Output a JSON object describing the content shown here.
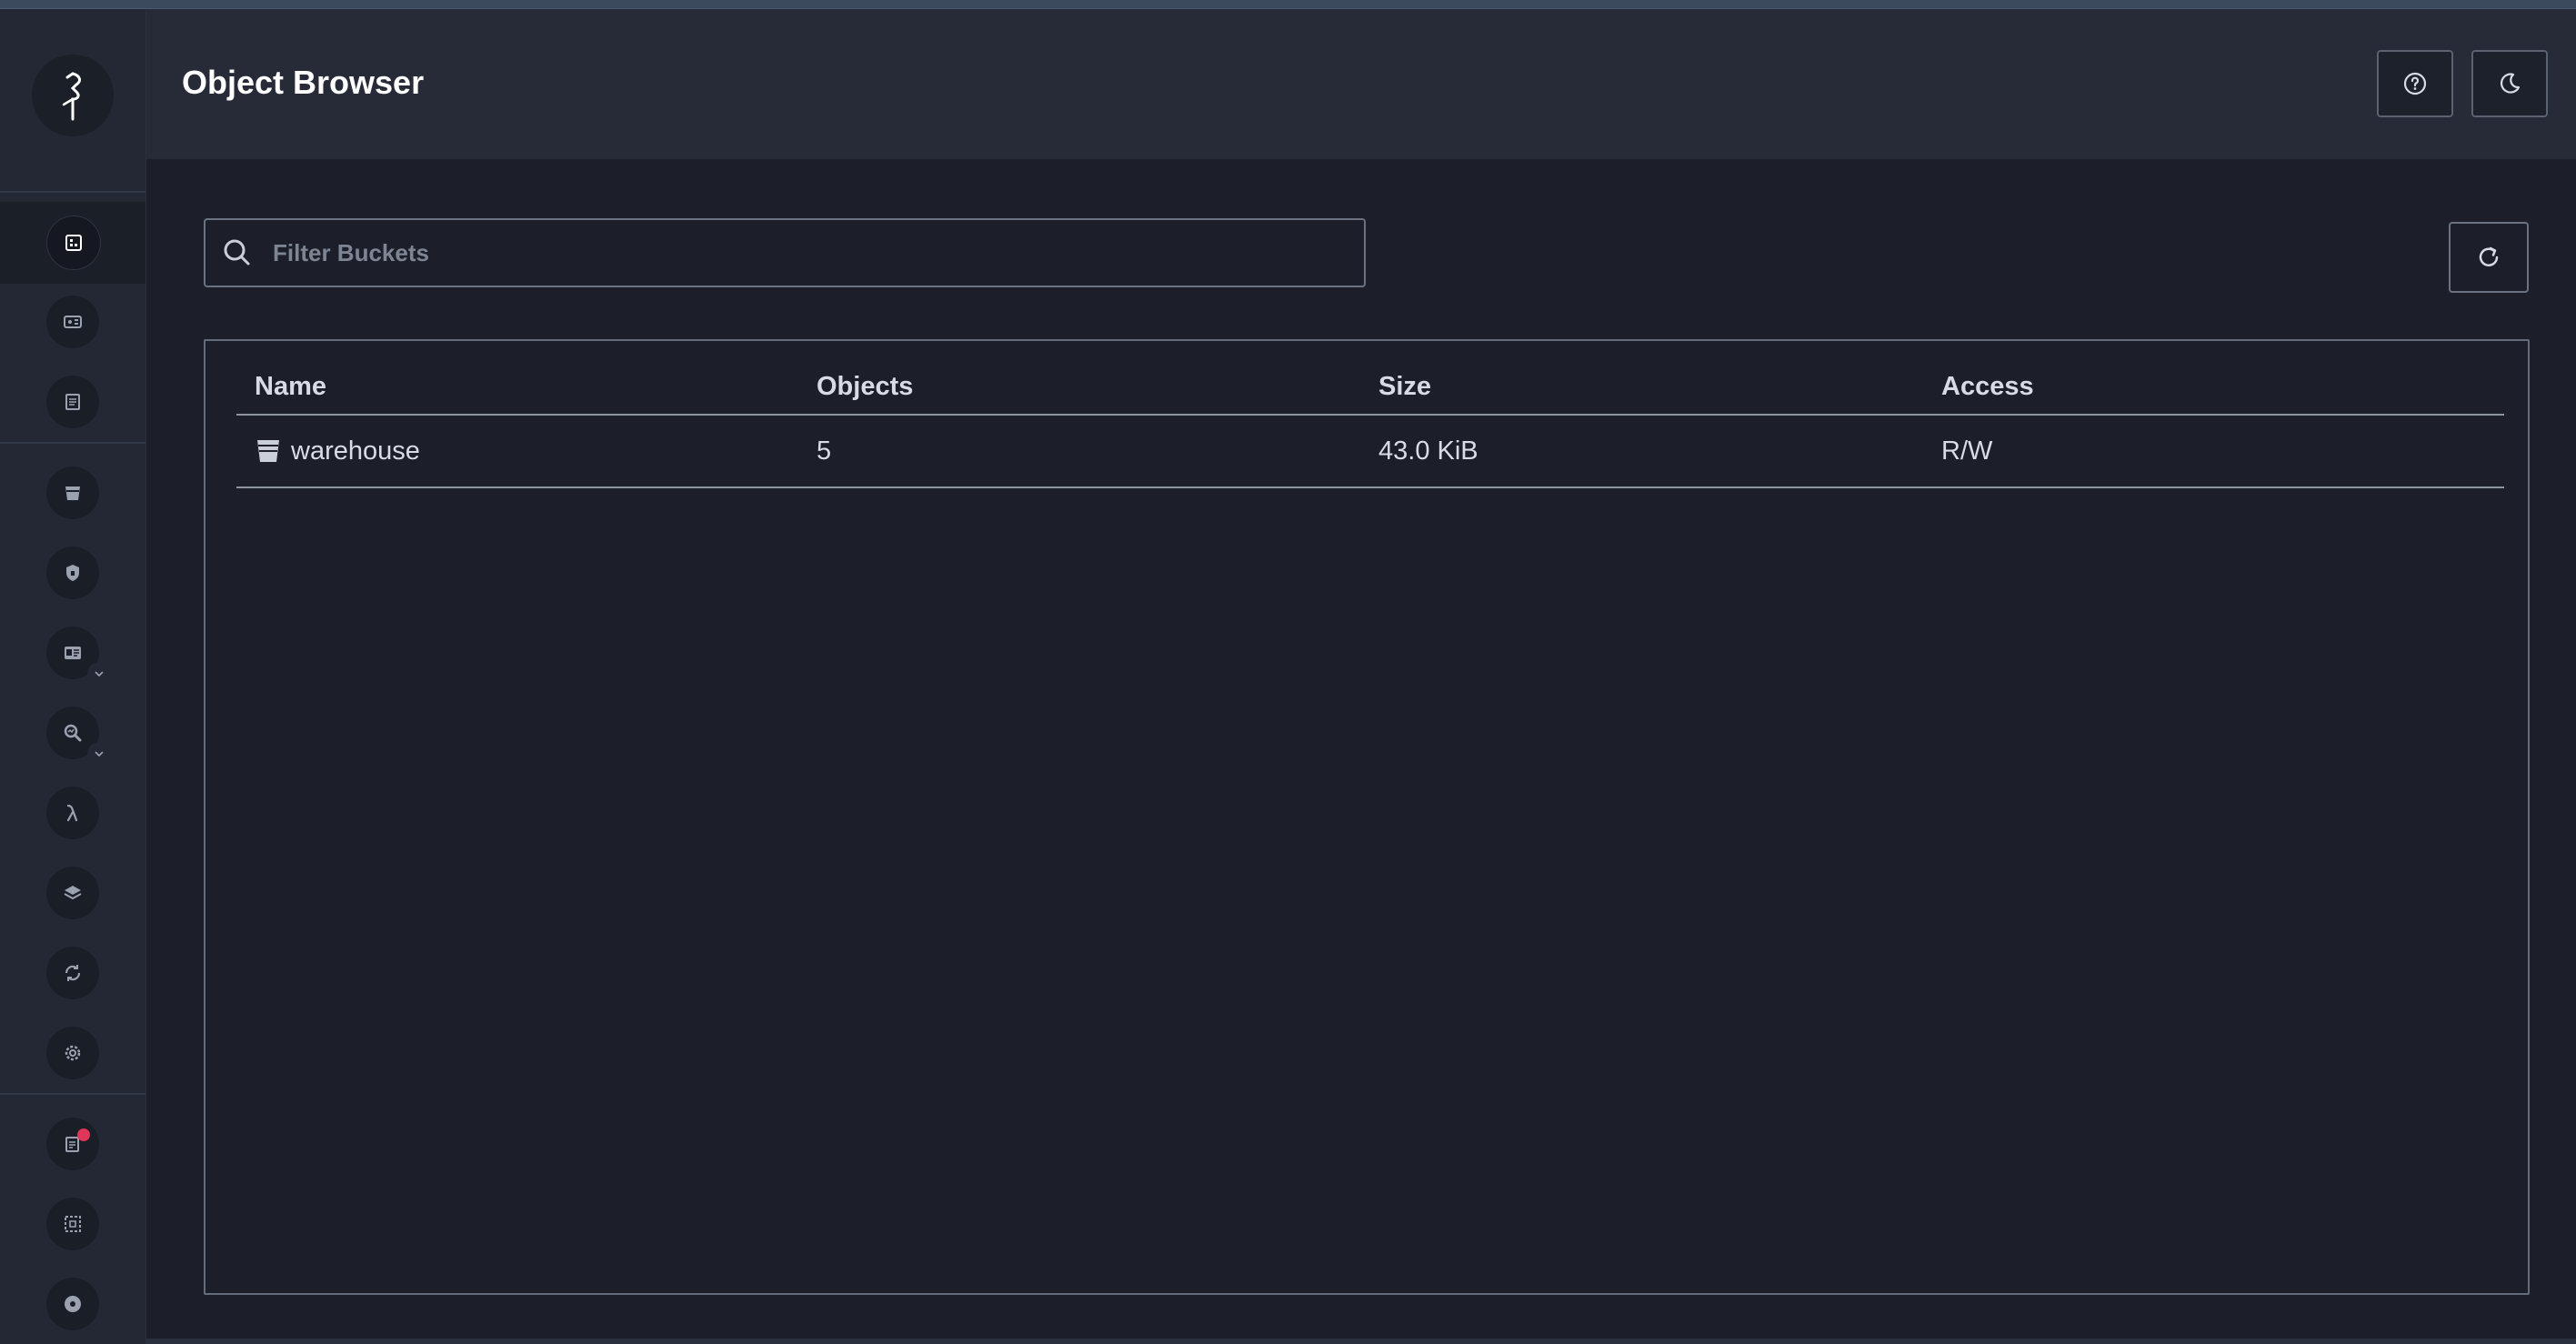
{
  "header": {
    "title": "Object Browser"
  },
  "toolbar": {
    "help_icon": "help-circle-icon",
    "theme_icon": "moon-icon",
    "refresh_icon": "refresh-icon"
  },
  "search": {
    "placeholder": "Filter Buckets",
    "value": ""
  },
  "sidebar": {
    "logo_icon": "minio-bird-logo",
    "items": [
      {
        "icon": "object-browser-icon",
        "active": true
      },
      {
        "icon": "access-keys-icon"
      },
      {
        "icon": "documentation-icon"
      },
      {
        "icon": "buckets-icon"
      },
      {
        "icon": "policies-icon"
      },
      {
        "icon": "identity-icon",
        "expandable": true
      },
      {
        "icon": "monitoring-icon",
        "expandable": true
      },
      {
        "icon": "events-lambda-icon"
      },
      {
        "icon": "tiering-layers-icon"
      },
      {
        "icon": "site-replication-icon"
      },
      {
        "icon": "settings-gear-icon"
      },
      {
        "icon": "notifications-icon",
        "badge": true
      },
      {
        "icon": "license-icon"
      },
      {
        "icon": "about-icon"
      }
    ]
  },
  "table": {
    "columns": [
      "Name",
      "Objects",
      "Size",
      "Access"
    ],
    "rows": [
      {
        "name": "warehouse",
        "objects": "5",
        "size": "43.0 KiB",
        "access": "R/W"
      }
    ]
  },
  "colors": {
    "background": "#1c1f29",
    "header_bg": "#262b37",
    "sidebar_bg": "#232834",
    "notification_badge": "#e0365a"
  }
}
